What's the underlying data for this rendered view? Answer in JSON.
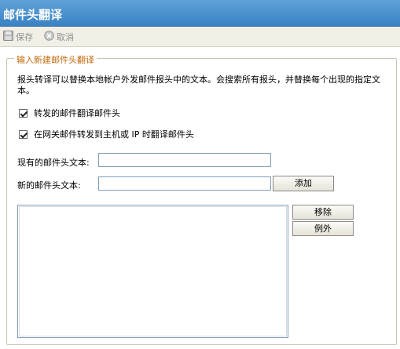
{
  "titlebar": {
    "title": "邮件头翻译"
  },
  "toolbar": {
    "save_label": "保存",
    "cancel_label": "取消",
    "save_icon": "floppy-disk-icon",
    "cancel_icon": "cancel-circle-icon"
  },
  "group": {
    "legend": "输入新建邮件头翻译",
    "description": "报头转译可以替换本地帐户外发邮件报头中的文本。会搜索所有报头，并替换每个出现的指定文本。",
    "checkboxes": [
      {
        "label": "转发的邮件翻译邮件头",
        "checked": true
      },
      {
        "label": "在网关邮件转发到主机或 IP 时翻译邮件头",
        "checked": true
      }
    ],
    "existing_label": "现有的邮件头文本:",
    "existing_value": "",
    "new_label": "新的邮件头文本:",
    "new_value": "",
    "add_label": "添加",
    "remove_label": "移除",
    "exception_label": "例外",
    "list_items": []
  },
  "colors": {
    "title_bar": "#3a82c4",
    "legend_text": "#c06a0c",
    "toolbar_bg": "#f1efe6"
  }
}
